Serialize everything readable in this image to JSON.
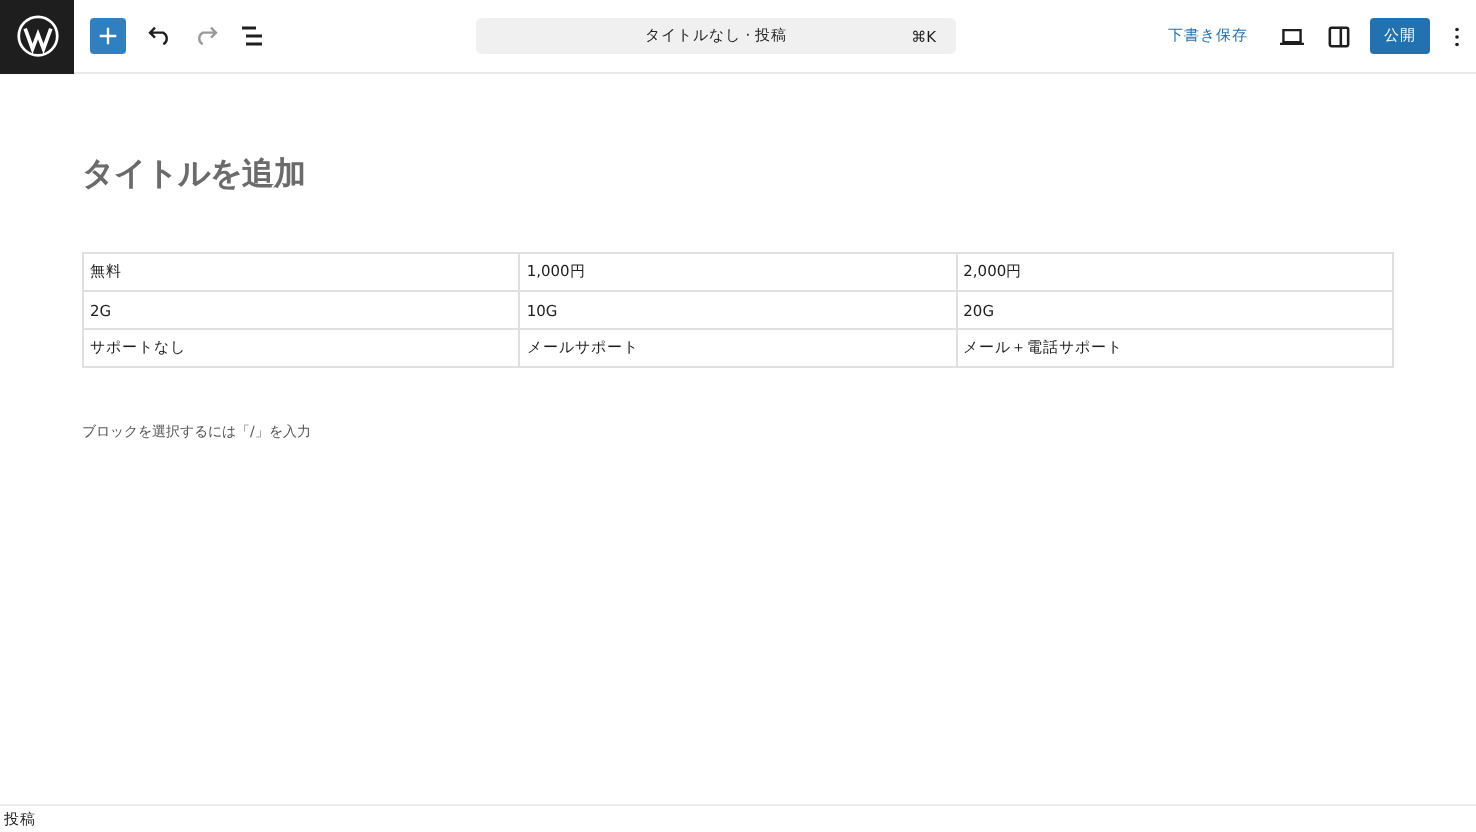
{
  "toolbar": {
    "command_bar": {
      "title": "タイトルなし · 投稿",
      "shortcut": "⌘K"
    },
    "save_draft": "下書き保存",
    "publish": "公開"
  },
  "editor": {
    "title_placeholder": "タイトルを追加",
    "table": {
      "rows": [
        [
          "無料",
          "1,000円",
          "2,000円"
        ],
        [
          "2G",
          "10G",
          "20G"
        ],
        [
          "サポートなし",
          "メールサポート",
          "メール＋電話サポート"
        ]
      ]
    },
    "block_hint": "ブロックを選択するには「/」を入力"
  },
  "status_bar": {
    "breadcrumb": "投稿"
  }
}
